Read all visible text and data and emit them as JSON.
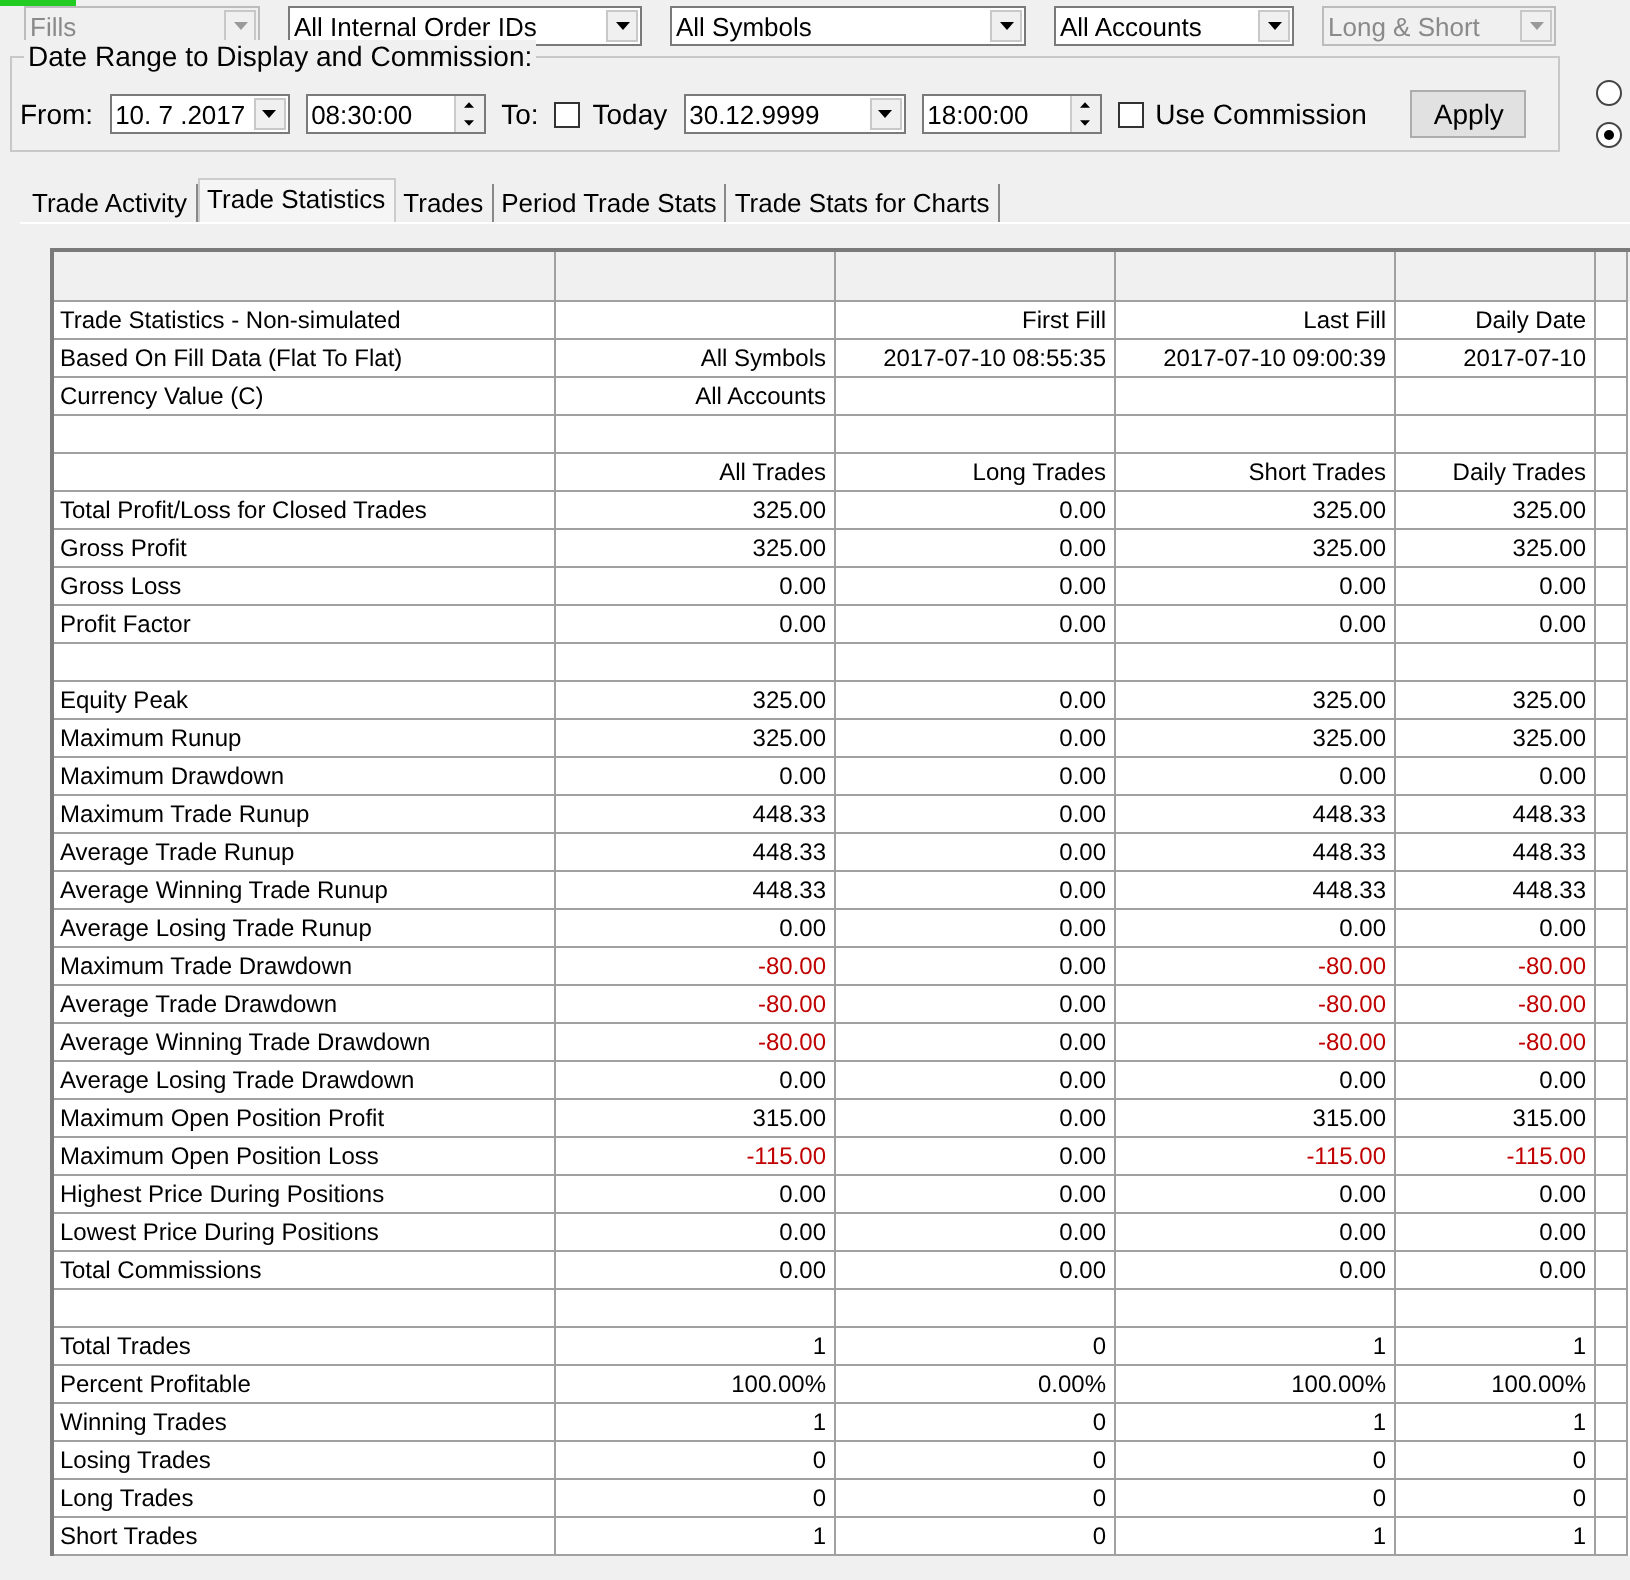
{
  "filters": [
    {
      "value": "Fills",
      "disabled": true
    },
    {
      "value": "All Internal Order IDs",
      "disabled": false
    },
    {
      "value": "All Symbols",
      "disabled": false
    },
    {
      "value": "All Accounts",
      "disabled": false
    },
    {
      "value": "Long & Short",
      "disabled": true
    }
  ],
  "date_range": {
    "title": "Date Range to Display and Commission:",
    "from_label": "From:",
    "from_date": "10. 7 .2017",
    "from_time": "08:30:00",
    "to_label": "To:",
    "today": {
      "label": "Today",
      "checked": false
    },
    "to_date": "30.12.9999",
    "to_time": "18:00:00",
    "use_commission": {
      "label": "Use Commission",
      "checked": false
    },
    "apply": "Apply"
  },
  "radios": [
    {
      "selected": false
    },
    {
      "selected": true
    }
  ],
  "tabs": [
    {
      "label": "Trade Activity",
      "selected": false
    },
    {
      "label": "Trade Statistics",
      "selected": true
    },
    {
      "label": "Trades",
      "selected": false
    },
    {
      "label": "Period Trade Stats",
      "selected": false
    },
    {
      "label": "Trade Stats for Charts",
      "selected": false
    }
  ],
  "table": {
    "rows": [
      {
        "kind": "data",
        "cells": [
          {
            "text": "Trade Statistics - Non-simulated",
            "negative": false
          },
          null,
          {
            "text": "First Fill",
            "negative": false
          },
          {
            "text": "Last Fill",
            "negative": false
          },
          {
            "text": "Daily Date",
            "negative": false
          }
        ]
      },
      {
        "kind": "data",
        "cells": [
          {
            "text": "Based On Fill Data (Flat To Flat)",
            "negative": false
          },
          {
            "text": "All Symbols",
            "negative": false
          },
          {
            "text": "2017-07-10  08:55:35",
            "negative": false
          },
          {
            "text": "2017-07-10  09:00:39",
            "negative": false
          },
          {
            "text": "2017-07-10",
            "negative": false
          }
        ]
      },
      {
        "kind": "data",
        "cells": [
          {
            "text": "Currency Value (C)",
            "negative": false
          },
          {
            "text": "All Accounts",
            "negative": false
          },
          null,
          null,
          null
        ]
      },
      {
        "kind": "blank"
      },
      {
        "kind": "data",
        "cells": [
          null,
          {
            "text": "All Trades",
            "negative": false
          },
          {
            "text": "Long Trades",
            "negative": false
          },
          {
            "text": "Short Trades",
            "negative": false
          },
          {
            "text": "Daily Trades",
            "negative": false
          }
        ]
      },
      {
        "kind": "data",
        "cells": [
          {
            "text": "Total Profit/Loss for Closed Trades",
            "negative": false
          },
          {
            "text": "325.00",
            "negative": false
          },
          {
            "text": "0.00",
            "negative": false
          },
          {
            "text": "325.00",
            "negative": false
          },
          {
            "text": "325.00",
            "negative": false
          }
        ]
      },
      {
        "kind": "data",
        "cells": [
          {
            "text": "Gross Profit",
            "negative": false
          },
          {
            "text": "325.00",
            "negative": false
          },
          {
            "text": "0.00",
            "negative": false
          },
          {
            "text": "325.00",
            "negative": false
          },
          {
            "text": "325.00",
            "negative": false
          }
        ]
      },
      {
        "kind": "data",
        "cells": [
          {
            "text": "Gross Loss",
            "negative": false
          },
          {
            "text": "0.00",
            "negative": false
          },
          {
            "text": "0.00",
            "negative": false
          },
          {
            "text": "0.00",
            "negative": false
          },
          {
            "text": "0.00",
            "negative": false
          }
        ]
      },
      {
        "kind": "data",
        "cells": [
          {
            "text": "Profit Factor",
            "negative": false
          },
          {
            "text": "0.00",
            "negative": false
          },
          {
            "text": "0.00",
            "negative": false
          },
          {
            "text": "0.00",
            "negative": false
          },
          {
            "text": "0.00",
            "negative": false
          }
        ]
      },
      {
        "kind": "blank"
      },
      {
        "kind": "data",
        "cells": [
          {
            "text": "Equity Peak",
            "negative": false
          },
          {
            "text": "325.00",
            "negative": false
          },
          {
            "text": "0.00",
            "negative": false
          },
          {
            "text": "325.00",
            "negative": false
          },
          {
            "text": "325.00",
            "negative": false
          }
        ]
      },
      {
        "kind": "data",
        "cells": [
          {
            "text": "Maximum Runup",
            "negative": false
          },
          {
            "text": "325.00",
            "negative": false
          },
          {
            "text": "0.00",
            "negative": false
          },
          {
            "text": "325.00",
            "negative": false
          },
          {
            "text": "325.00",
            "negative": false
          }
        ]
      },
      {
        "kind": "data",
        "cells": [
          {
            "text": "Maximum Drawdown",
            "negative": false
          },
          {
            "text": "0.00",
            "negative": false
          },
          {
            "text": "0.00",
            "negative": false
          },
          {
            "text": "0.00",
            "negative": false
          },
          {
            "text": "0.00",
            "negative": false
          }
        ]
      },
      {
        "kind": "data",
        "cells": [
          {
            "text": "Maximum Trade Runup",
            "negative": false
          },
          {
            "text": "448.33",
            "negative": false
          },
          {
            "text": "0.00",
            "negative": false
          },
          {
            "text": "448.33",
            "negative": false
          },
          {
            "text": "448.33",
            "negative": false
          }
        ]
      },
      {
        "kind": "data",
        "cells": [
          {
            "text": "Average Trade Runup",
            "negative": false
          },
          {
            "text": "448.33",
            "negative": false
          },
          {
            "text": "0.00",
            "negative": false
          },
          {
            "text": "448.33",
            "negative": false
          },
          {
            "text": "448.33",
            "negative": false
          }
        ]
      },
      {
        "kind": "data",
        "cells": [
          {
            "text": "Average Winning Trade Runup",
            "negative": false
          },
          {
            "text": "448.33",
            "negative": false
          },
          {
            "text": "0.00",
            "negative": false
          },
          {
            "text": "448.33",
            "negative": false
          },
          {
            "text": "448.33",
            "negative": false
          }
        ]
      },
      {
        "kind": "data",
        "cells": [
          {
            "text": "Average Losing Trade Runup",
            "negative": false
          },
          {
            "text": "0.00",
            "negative": false
          },
          {
            "text": "0.00",
            "negative": false
          },
          {
            "text": "0.00",
            "negative": false
          },
          {
            "text": "0.00",
            "negative": false
          }
        ]
      },
      {
        "kind": "data",
        "cells": [
          {
            "text": "Maximum Trade Drawdown",
            "negative": false
          },
          {
            "text": "-80.00",
            "negative": true
          },
          {
            "text": "0.00",
            "negative": false
          },
          {
            "text": "-80.00",
            "negative": true
          },
          {
            "text": "-80.00",
            "negative": true
          }
        ]
      },
      {
        "kind": "data",
        "cells": [
          {
            "text": "Average Trade Drawdown",
            "negative": false
          },
          {
            "text": "-80.00",
            "negative": true
          },
          {
            "text": "0.00",
            "negative": false
          },
          {
            "text": "-80.00",
            "negative": true
          },
          {
            "text": "-80.00",
            "negative": true
          }
        ]
      },
      {
        "kind": "data",
        "cells": [
          {
            "text": "Average Winning Trade Drawdown",
            "negative": false
          },
          {
            "text": "-80.00",
            "negative": true
          },
          {
            "text": "0.00",
            "negative": false
          },
          {
            "text": "-80.00",
            "negative": true
          },
          {
            "text": "-80.00",
            "negative": true
          }
        ]
      },
      {
        "kind": "data",
        "cells": [
          {
            "text": "Average Losing Trade Drawdown",
            "negative": false
          },
          {
            "text": "0.00",
            "negative": false
          },
          {
            "text": "0.00",
            "negative": false
          },
          {
            "text": "0.00",
            "negative": false
          },
          {
            "text": "0.00",
            "negative": false
          }
        ]
      },
      {
        "kind": "data",
        "cells": [
          {
            "text": "Maximum Open Position Profit",
            "negative": false
          },
          {
            "text": "315.00",
            "negative": false
          },
          {
            "text": "0.00",
            "negative": false
          },
          {
            "text": "315.00",
            "negative": false
          },
          {
            "text": "315.00",
            "negative": false
          }
        ]
      },
      {
        "kind": "data",
        "cells": [
          {
            "text": "Maximum Open Position Loss",
            "negative": false
          },
          {
            "text": "-115.00",
            "negative": true
          },
          {
            "text": "0.00",
            "negative": false
          },
          {
            "text": "-115.00",
            "negative": true
          },
          {
            "text": "-115.00",
            "negative": true
          }
        ]
      },
      {
        "kind": "data",
        "cells": [
          {
            "text": "Highest Price During Positions",
            "negative": false
          },
          {
            "text": "0.00",
            "negative": false
          },
          {
            "text": "0.00",
            "negative": false
          },
          {
            "text": "0.00",
            "negative": false
          },
          {
            "text": "0.00",
            "negative": false
          }
        ]
      },
      {
        "kind": "data",
        "cells": [
          {
            "text": "Lowest Price During Positions",
            "negative": false
          },
          {
            "text": "0.00",
            "negative": false
          },
          {
            "text": "0.00",
            "negative": false
          },
          {
            "text": "0.00",
            "negative": false
          },
          {
            "text": "0.00",
            "negative": false
          }
        ]
      },
      {
        "kind": "data",
        "cells": [
          {
            "text": "Total Commissions",
            "negative": false
          },
          {
            "text": "0.00",
            "negative": false
          },
          {
            "text": "0.00",
            "negative": false
          },
          {
            "text": "0.00",
            "negative": false
          },
          {
            "text": "0.00",
            "negative": false
          }
        ]
      },
      {
        "kind": "blank"
      },
      {
        "kind": "data",
        "cells": [
          {
            "text": "Total Trades",
            "negative": false
          },
          {
            "text": "1",
            "negative": false
          },
          {
            "text": "0",
            "negative": false
          },
          {
            "text": "1",
            "negative": false
          },
          {
            "text": "1",
            "negative": false
          }
        ]
      },
      {
        "kind": "data",
        "cells": [
          {
            "text": "Percent Profitable",
            "negative": false
          },
          {
            "text": "100.00%",
            "negative": false
          },
          {
            "text": "0.00%",
            "negative": false
          },
          {
            "text": "100.00%",
            "negative": false
          },
          {
            "text": "100.00%",
            "negative": false
          }
        ]
      },
      {
        "kind": "data",
        "cells": [
          {
            "text": "Winning Trades",
            "negative": false
          },
          {
            "text": "1",
            "negative": false
          },
          {
            "text": "0",
            "negative": false
          },
          {
            "text": "1",
            "negative": false
          },
          {
            "text": "1",
            "negative": false
          }
        ]
      },
      {
        "kind": "data",
        "cells": [
          {
            "text": "Losing Trades",
            "negative": false
          },
          {
            "text": "0",
            "negative": false
          },
          {
            "text": "0",
            "negative": false
          },
          {
            "text": "0",
            "negative": false
          },
          {
            "text": "0",
            "negative": false
          }
        ]
      },
      {
        "kind": "data",
        "cells": [
          {
            "text": "Long Trades",
            "negative": false
          },
          {
            "text": "0",
            "negative": false
          },
          {
            "text": "0",
            "negative": false
          },
          {
            "text": "0",
            "negative": false
          },
          {
            "text": "0",
            "negative": false
          }
        ]
      },
      {
        "kind": "data",
        "cells": [
          {
            "text": "Short Trades",
            "negative": false
          },
          {
            "text": "1",
            "negative": false
          },
          {
            "text": "0",
            "negative": false
          },
          {
            "text": "1",
            "negative": false
          },
          {
            "text": "1",
            "negative": false
          }
        ]
      }
    ]
  }
}
